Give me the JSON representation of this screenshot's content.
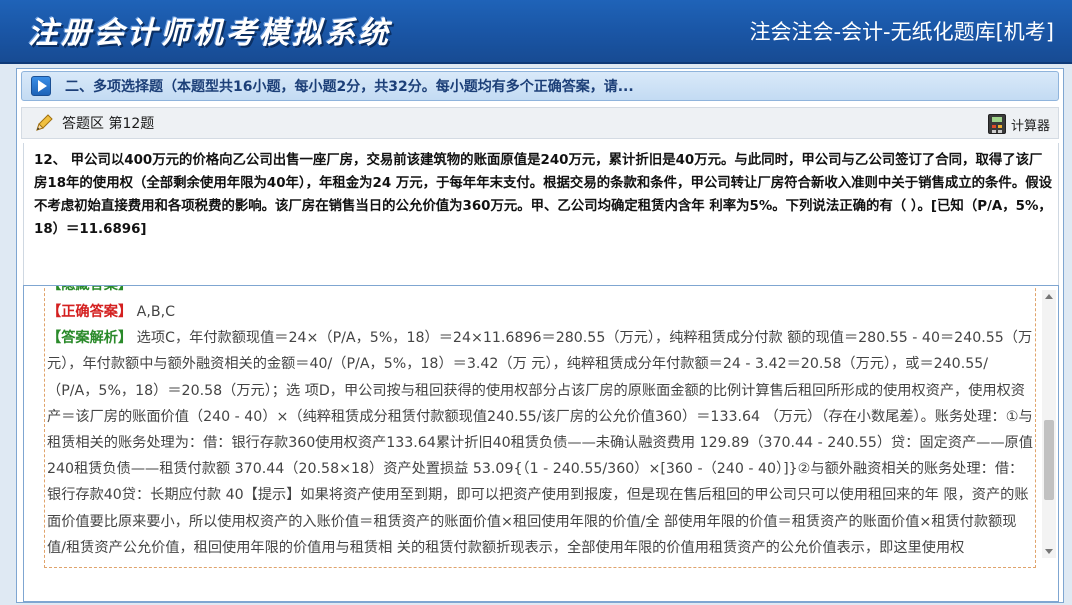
{
  "header": {
    "app_title": "注册会计师机考模拟系统",
    "system_name": "注会注会-会计-无纸化题库[机考]"
  },
  "section": {
    "title": "二、多项选择题（本题型共16小题，每小题2分，共32分。每小题均有多个正确答案，请..."
  },
  "answer_area": {
    "label": "答题区 第12题",
    "calculator_label": "计算器"
  },
  "question": {
    "text": "12、 甲公司以400万元的价格向乙公司出售一座厂房，交易前该建筑物的账面原值是240万元，累计折旧是40万元。与此同时，甲公司与乙公司签订了合同，取得了该厂房18年的使用权（全部剩余使用年限为40年），年租金为24 万元，于每年年末支付。根据交易的条款和条件，甲公司转让厂房符合新收入准则中关于销售成立的条件。假设 不考虑初始直接费用和各项税费的影响。该厂房在销售当日的公允价值为360万元。甲、乙公司均确定租赁内含年 利率为5%。下列说法正确的有（ ）。[已知（P/A，5%，18）＝11.6896]"
  },
  "analysis": {
    "cut_label": "【隐藏答案】",
    "correct_label": "【正确答案】",
    "correct_value": "A,B,C",
    "explain_label": "【答案解析】",
    "explain_text": "选项C，年付款额现值＝24×（P/A，5%，18）＝24×11.6896＝280.55（万元），纯粹租赁成分付款 额的现值＝280.55 - 40＝240.55（万元），年付款额中与额外融资相关的金额＝40/（P/A，5%，18）＝3.42（万 元），纯粹租赁成分年付款额＝24 - 3.42＝20.58（万元），或＝240.55/（P/A，5%，18）＝20.58（万元）；选 项D，甲公司按与租回获得的使用权部分占该厂房的原账面金额的比例计算售后租回所形成的使用权资产，使用权资产＝该厂房的账面价值（240 - 40）×（纯粹租赁成分租赁付款额现值240.55/该厂房的公允价值360）＝133.64 （万元）（存在小数尾差）。账务处理：①与租赁相关的账务处理为：借：银行存款360使用权资产133.64累计折旧40租赁负债——未确认融资费用 129.89（370.44 - 240.55）贷：固定资产——原值 240租赁负债——租赁付款额 370.44（20.58×18）资产处置损益 53.09{（1 - 240.55/360）×[360 -（240 - 40）]}②与额外融资相关的账务处理：借：银行存款40贷：长期应付款 40【提示】如果将资产使用至到期，即可以把资产使用到报废，但是现在售后租回的甲公司只可以使用租回来的年 限，资产的账面价值要比原来要小，所以使用权资产的入账价值＝租赁资产的账面价值×租回使用年限的价值/全 部使用年限的价值＝租赁资产的账面价值×租赁付款额现值/租赁资产公允价值，租回使用年限的价值用与租赁相 关的租赁付款额折现表示，全部使用年限的价值用租赁资产的公允价值表示，即这里使用权"
  },
  "colors": {
    "header_bg": "#1a56a6",
    "correct_label": "#d42020",
    "explain_label": "#2a8a2a"
  },
  "icons": [
    "play-icon",
    "pencil-icon",
    "calculator-icon",
    "scroll-up-arrow",
    "scroll-down-arrow"
  ]
}
